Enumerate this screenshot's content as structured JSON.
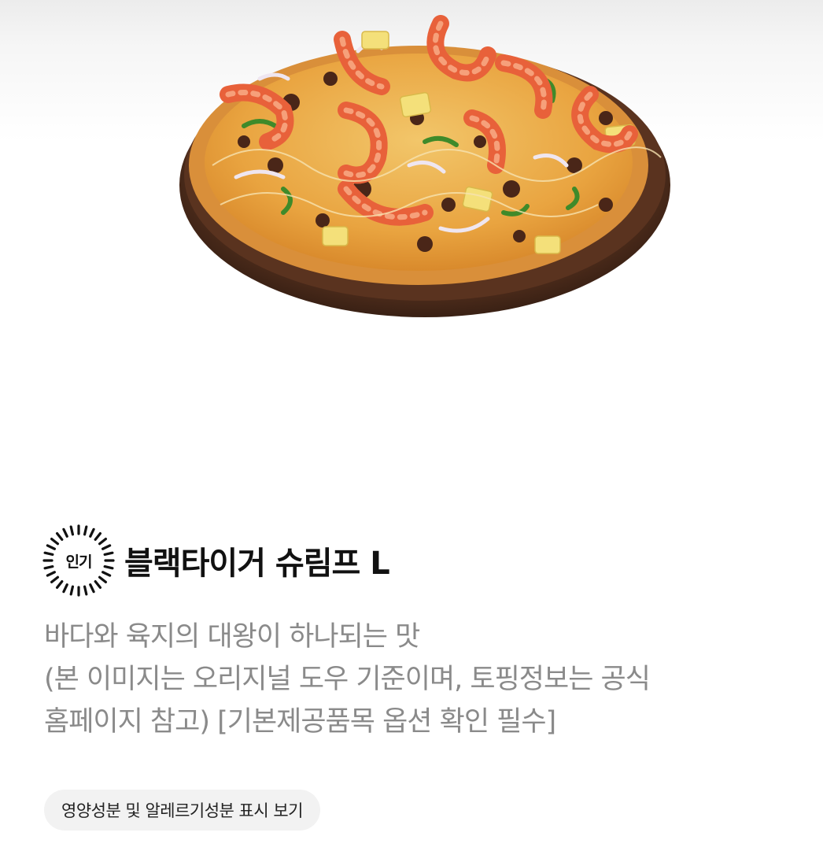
{
  "product": {
    "image_alt": "블랙타이거 슈림프 피자",
    "badge_label": "인기",
    "name": "블랙타이거 슈림프 L",
    "description_lines": [
      "바다와 육지의 대왕이 하나되는 맛",
      "(본 이미지는 오리지널 도우 기준이며, 토핑정보는 공식",
      "홈페이지 참고) [기본제공품목 옵션 확인 필수]"
    ],
    "nutrition_button_label": "영양성분 및 알레르기성분 표시 보기"
  },
  "colors": {
    "title": "#111111",
    "description": "#8a8a8a",
    "button_bg": "#f2f2f2",
    "board": "#4a2a1a",
    "crust": "#e7a23a",
    "shrimp": "#e8613a"
  }
}
